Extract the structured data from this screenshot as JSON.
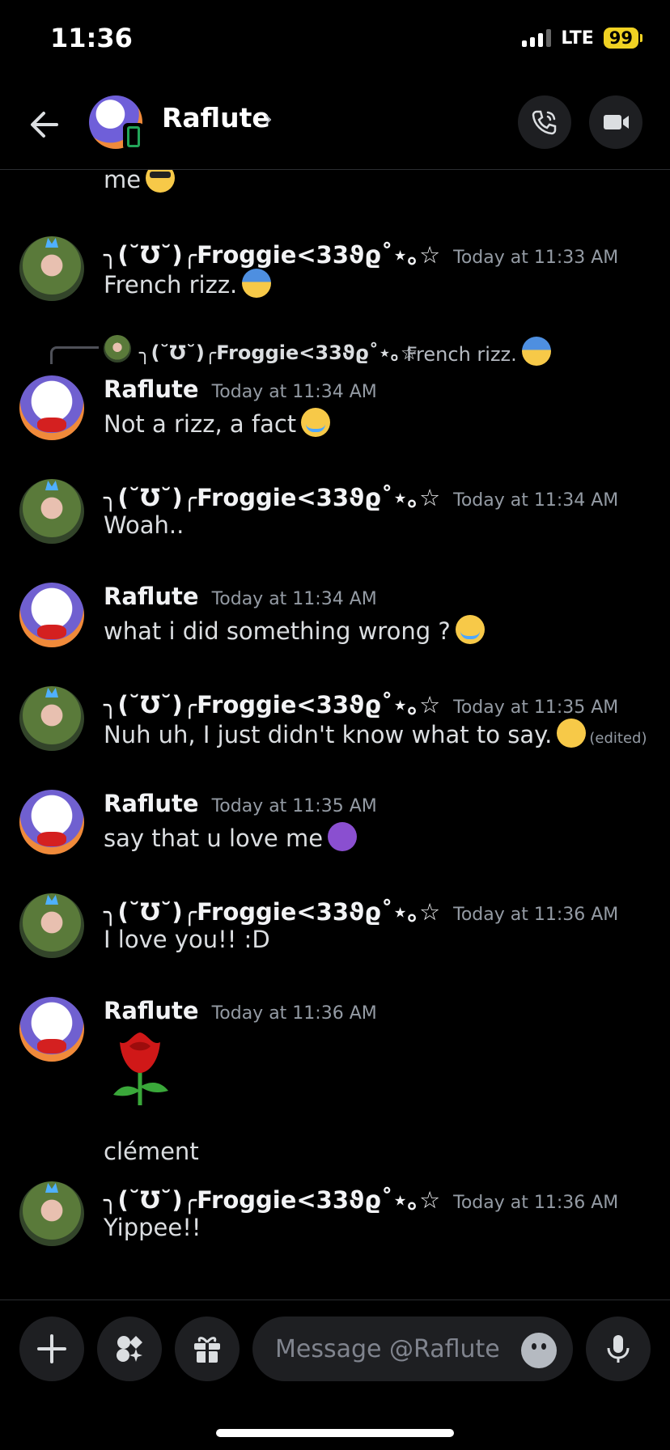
{
  "status_bar": {
    "time": "11:36",
    "network": "LTE",
    "battery": "99"
  },
  "header": {
    "title": "Raflute",
    "chevron": "›"
  },
  "messages": {
    "partial_text": "me",
    "m1": {
      "author": "╮(˘Ʊ˘)╭Froggie<33ϑϱ˚⋆｡☆",
      "time": "Today at 11:33 AM",
      "text": "French rizz."
    },
    "reply": {
      "author": "╮(˘Ʊ˘)╭Froggie<33ϑϱ˚⋆｡☆",
      "text": "French rizz."
    },
    "m2": {
      "author": "Raflute",
      "time": "Today at 11:34 AM",
      "text": "Not a rizz, a fact"
    },
    "m3": {
      "author": "╮(˘Ʊ˘)╭Froggie<33ϑϱ˚⋆｡☆",
      "time": "Today at 11:34 AM",
      "text": "Woah.."
    },
    "m4": {
      "author": "Raflute",
      "time": "Today at 11:34 AM",
      "text": "what i did something wrong ?"
    },
    "m5": {
      "author": "╮(˘Ʊ˘)╭Froggie<33ϑϱ˚⋆｡☆",
      "time": "Today at 11:35 AM",
      "text": "Nuh uh, I just didn't know what to say.",
      "edited": "(edited)"
    },
    "m6": {
      "author": "Raflute",
      "time": "Today at 11:35 AM",
      "text": "say that u love me"
    },
    "m7": {
      "author": "╮(˘Ʊ˘)╭Froggie<33ϑϱ˚⋆｡☆",
      "time": "Today at 11:36 AM",
      "text": "I love you!! :D"
    },
    "m8": {
      "author": "Raflute",
      "time": "Today at 11:36 AM",
      "text": "clément"
    },
    "m9": {
      "author": "╮(˘Ʊ˘)╭Froggie<33ϑϱ˚⋆｡☆",
      "time": "Today at 11:36 AM",
      "text": "Yippee!!"
    }
  },
  "composer": {
    "placeholder": "Message @Raflute"
  },
  "colors": {
    "background": "#000000",
    "online": "#23a559",
    "battery": "#f0d223"
  }
}
